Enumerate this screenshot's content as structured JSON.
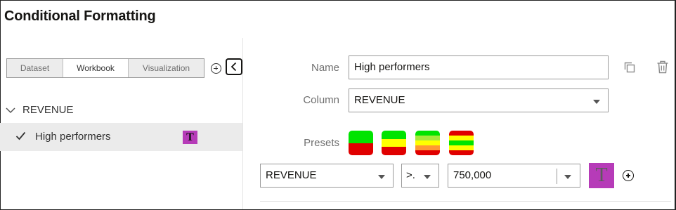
{
  "dialog": {
    "title": "Conditional Formatting"
  },
  "scope_tabs": [
    {
      "label": "Dataset",
      "active": false
    },
    {
      "label": "Workbook",
      "active": true
    },
    {
      "label": "Visualization",
      "active": false
    }
  ],
  "icons": {
    "add_rule": "plus-circle-icon",
    "collapse": "chevron-left-icon",
    "group_toggle": "chevron-down-icon",
    "rule_enabled": "check-icon",
    "duplicate": "copy-icon",
    "delete": "trash-icon",
    "add_condition": "plus-circle-icon"
  },
  "rules_panel": {
    "group_label": "REVENUE",
    "rules": [
      {
        "name": "High performers",
        "checked": true,
        "format_glyph": "T",
        "format_color": "#b63bb8"
      }
    ]
  },
  "editor": {
    "name_label": "Name",
    "name_value": "High performers",
    "column_label": "Column",
    "column_value": "REVENUE",
    "presets_label": "Presets",
    "presets": [
      {
        "colors": [
          "#00e400",
          "#e00000"
        ]
      },
      {
        "colors": [
          "#00e400",
          "#ffff00",
          "#e00000"
        ]
      },
      {
        "colors": [
          "#00e400",
          "#a8e83a",
          "#ffff00",
          "#ff9933",
          "#e00000"
        ]
      },
      {
        "colors": [
          "#e00000",
          "#ffff00",
          "#00e400",
          "#ffff00",
          "#e00000"
        ]
      }
    ],
    "condition": {
      "field_value": "REVENUE",
      "operator_value": ">.",
      "threshold_value": "750,000",
      "format_glyph": "T",
      "format_color": "#b63bb8"
    }
  }
}
